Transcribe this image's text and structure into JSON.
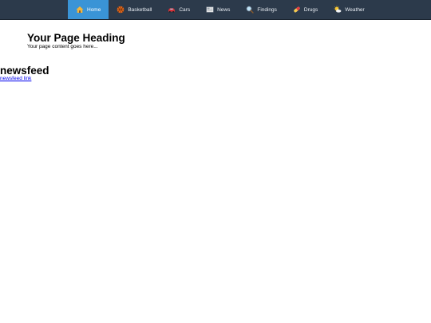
{
  "nav": {
    "items": [
      {
        "label": "Home",
        "icon": "home-icon",
        "active": true
      },
      {
        "label": "Basketball",
        "icon": "basketball-icon",
        "active": false
      },
      {
        "label": "Cars",
        "icon": "car-icon",
        "active": false
      },
      {
        "label": "News",
        "icon": "newspaper-icon",
        "active": false
      },
      {
        "label": "Findings",
        "icon": "magnifier-icon",
        "active": false
      },
      {
        "label": "Drugs",
        "icon": "pill-icon",
        "active": false
      },
      {
        "label": "Weather",
        "icon": "sun-cloud-icon",
        "active": false
      }
    ],
    "colors": {
      "bar": "#2c3a4b",
      "active": "#3a94d6"
    }
  },
  "main": {
    "heading": "Your Page Heading",
    "content": "Your page content goes here..."
  },
  "newsfeed": {
    "heading": "newsfeed",
    "link_label": "newsfeed link"
  }
}
